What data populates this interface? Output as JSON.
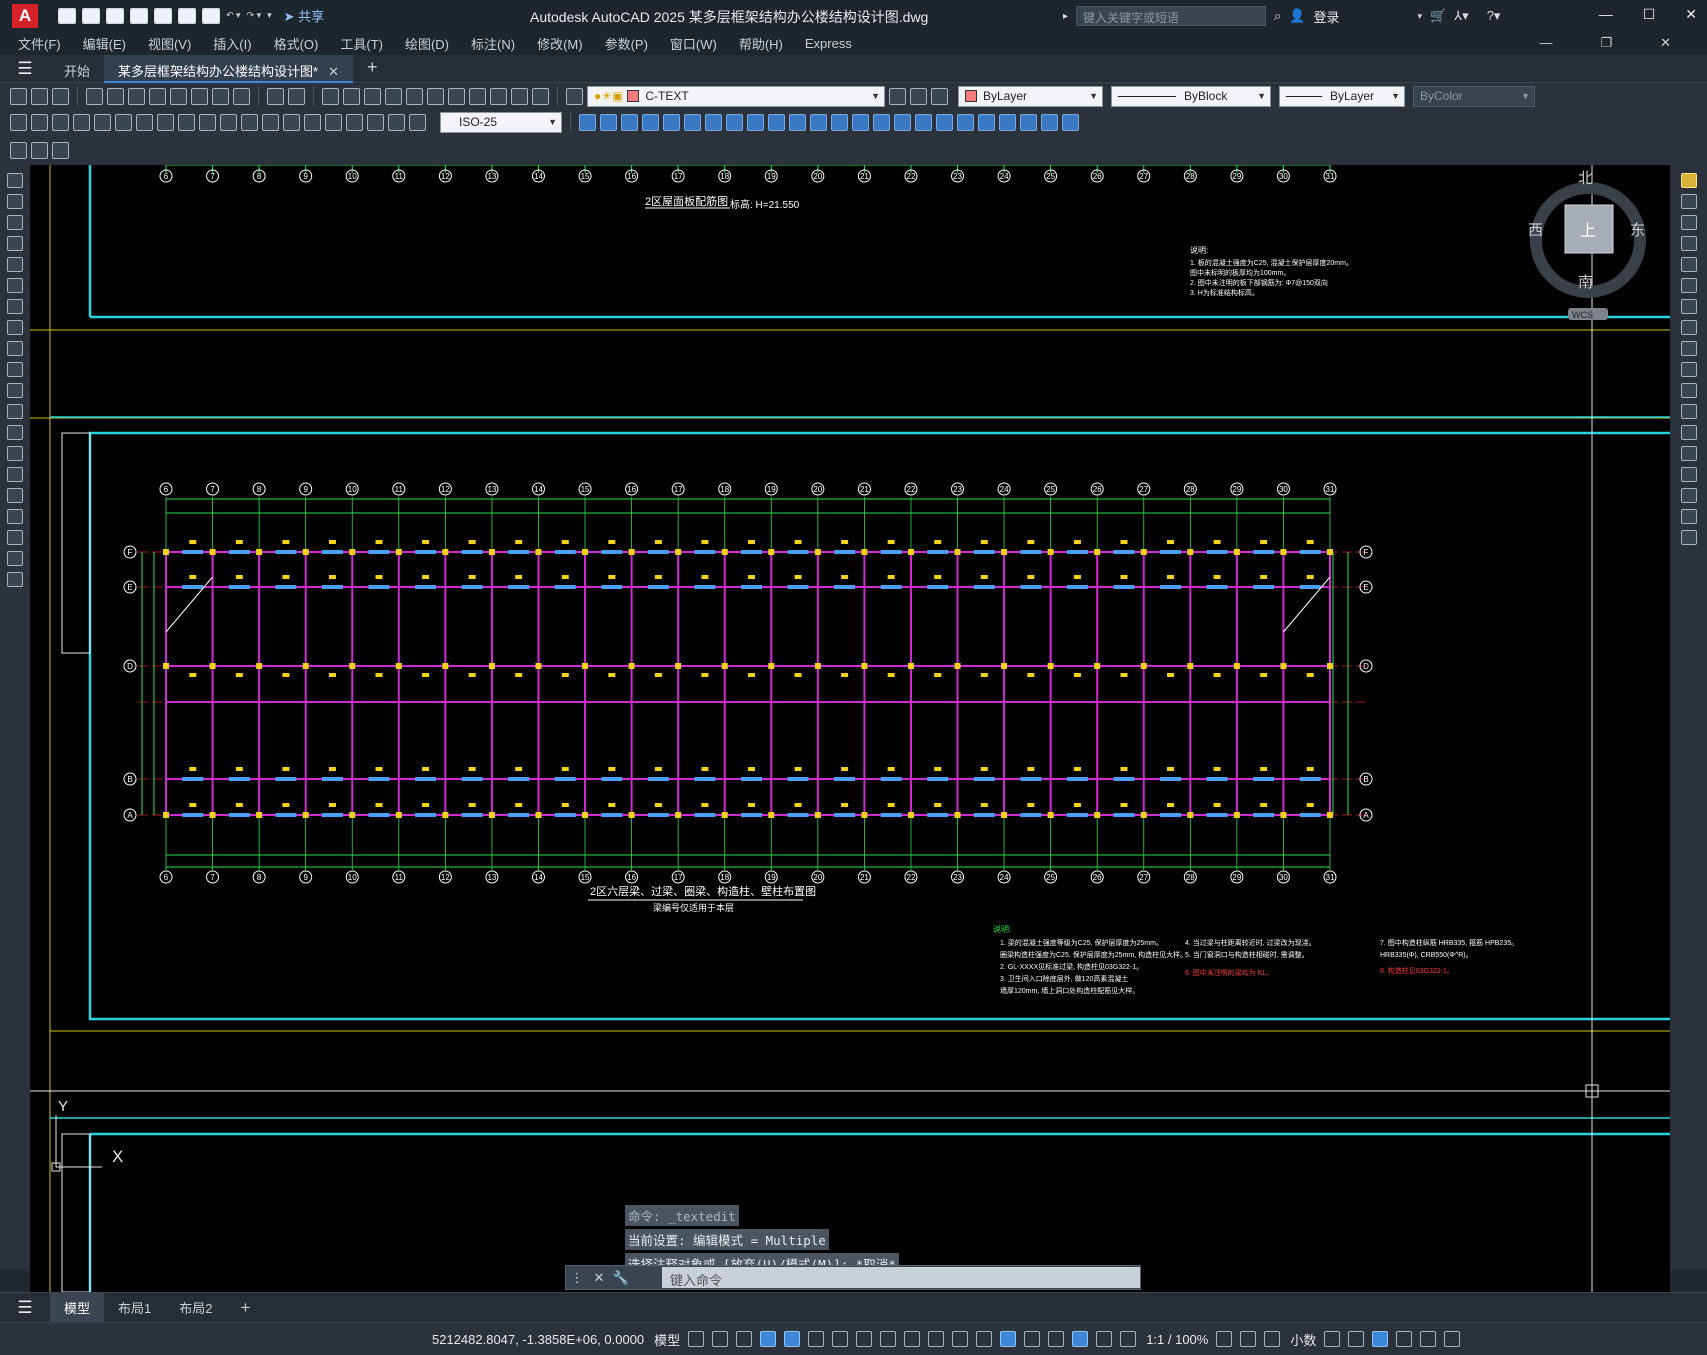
{
  "app": {
    "title": "Autodesk AutoCAD 2025    某多层框架结构办公楼结构设计图.dwg",
    "logo": "A",
    "share": "共享",
    "search_placeholder": "键入关键字或短语",
    "login": "登录"
  },
  "menu": [
    "文件(F)",
    "编辑(E)",
    "视图(V)",
    "插入(I)",
    "格式(O)",
    "工具(T)",
    "绘图(D)",
    "标注(N)",
    "修改(M)",
    "参数(P)",
    "窗口(W)",
    "帮助(H)",
    "Express"
  ],
  "tabs": {
    "start": "开始",
    "doc": "某多层框架结构办公楼结构设计图*"
  },
  "toolbar": {
    "layer": "C-TEXT",
    "color": "ByLayer",
    "linetype": "ByBlock",
    "lineweight": "ByLayer",
    "plotstyle": "ByColor",
    "dimstyle": "ISO-25"
  },
  "drawing": {
    "top_title": "2区屋面板配筋图",
    "top_elev": "标高: H=21.550",
    "main_title": "2区六层梁、过梁、圈梁、构造柱、壁柱布置图",
    "main_subtitle": "梁编号仅适用于本层",
    "notes_head": "说明:",
    "top_notes": [
      "1. 板的混凝土强度为C25, 混凝土保护层厚度20mm。",
      "   图中未标明的板厚均为100mm。",
      "2. 图中未注明的板下部钢筋为: Φ7@150双向",
      "3. H为标准结构标高。"
    ],
    "notes_col1": [
      "1. 梁的混凝土强度等级为C25, 保护层厚度为25mm。",
      "   圈梁构造柱强度为C25, 保护层厚度为25mm, 构造柱见大样。",
      "2. GL-XXXX见标准过梁, 构造柱见03G322-1。",
      "3. 卫生间入口除底层外, 做120高素混凝土",
      "   墙厚120mm, 墙上洞口处构造柱配筋见大样。"
    ],
    "notes_col2": [
      "4. 当过梁与柱距离较近时, 过梁改为现浇。",
      "5. 当门窗洞口与构造柱相碰时, 需调整。",
      "6. 图中未注明的梁均为 KL。"
    ],
    "notes_col3": [
      "7. 图中构造柱纵筋 HRB335, 箍筋 HPB235。",
      "   HRB335(Φ), CRB550(Φ^R)。",
      "8. 构造柱见03G322-1。"
    ],
    "axes_x": [
      "6",
      "7",
      "8",
      "9",
      "10",
      "11",
      "12",
      "13",
      "14",
      "15",
      "16",
      "17",
      "18",
      "19",
      "20",
      "21",
      "22",
      "23",
      "24",
      "25",
      "26",
      "27",
      "28",
      "29",
      "30",
      "31"
    ],
    "axes_y": [
      "F",
      "E",
      "D",
      "B",
      "A"
    ],
    "compass": {
      "n": "北",
      "s": "南",
      "e": "东",
      "w": "西",
      "top": "上",
      "wcs": "WCS"
    },
    "ucs": {
      "y": "Y",
      "x": "X"
    }
  },
  "command": {
    "history": [
      "命令: _textedit",
      "当前设置: 编辑模式 = Multiple",
      "选择注释对象或 [放弃(U)/模式(M)]: *取消*"
    ],
    "placeholder": "键入命令"
  },
  "layouts": [
    "模型",
    "布局1",
    "布局2"
  ],
  "status": {
    "coords": "5212482.8047, -1.3858E+06, 0.0000",
    "mode": "模型",
    "scale": "1:1 / 100%",
    "units": "小数"
  }
}
